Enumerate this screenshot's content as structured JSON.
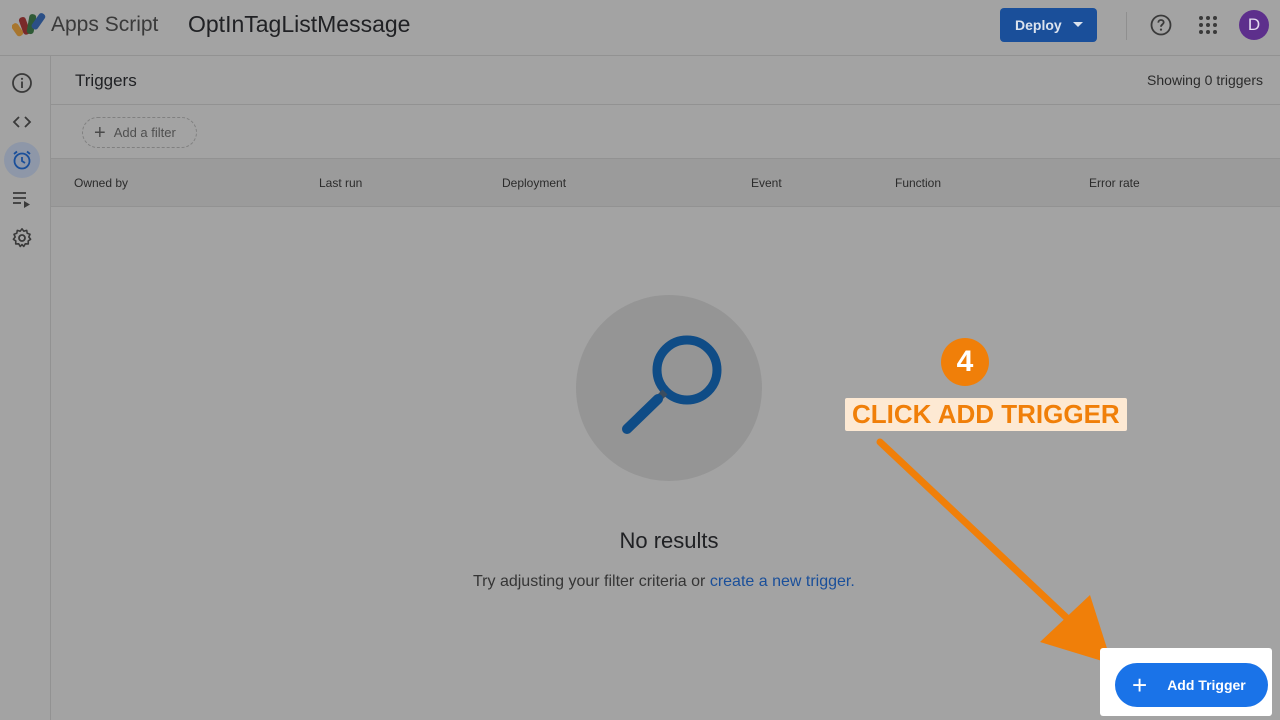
{
  "header": {
    "app_name": "Apps Script",
    "project_title": "OptInTagListMessage",
    "deploy_label": "Deploy",
    "avatar_initial": "D",
    "icons": [
      "apps-script-logo",
      "help-icon",
      "apps-grid-icon"
    ]
  },
  "sidebar": {
    "items": [
      {
        "name": "overview",
        "icon": "info-icon",
        "active": false
      },
      {
        "name": "editor",
        "icon": "code-icon",
        "active": false
      },
      {
        "name": "triggers",
        "icon": "alarm-clock-icon",
        "active": true
      },
      {
        "name": "executions",
        "icon": "playlist-icon",
        "active": false
      },
      {
        "name": "settings",
        "icon": "gear-icon",
        "active": false
      }
    ]
  },
  "main": {
    "title": "Triggers",
    "showing_text": "Showing 0 triggers",
    "filter_label": "Add a filter",
    "columns": [
      "Owned by",
      "Last run",
      "Deployment",
      "Event",
      "Function",
      "Error rate"
    ],
    "empty_title": "No results",
    "empty_hint_prefix": "Try adjusting your filter criteria or ",
    "empty_hint_link": "create a new trigger."
  },
  "annotation": {
    "step_number": "4",
    "callout_text": "CLICK ADD TRIGGER",
    "accent_color": "#f07f09"
  },
  "fab": {
    "label": "Add Trigger",
    "color": "#1a73e8"
  }
}
